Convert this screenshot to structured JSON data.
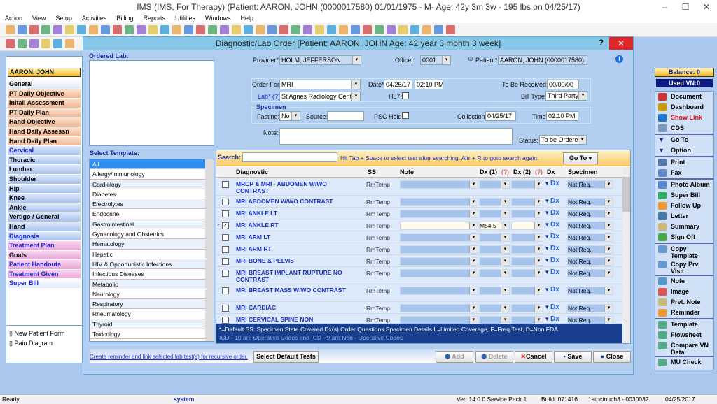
{
  "app": {
    "title": "IMS (IMS, For Therapy)    (Patient: AARON, JOHN  (0000017580) 01/01/1975 - M- Age: 42y 3m 3w - 195 lbs on 04/25/17)"
  },
  "menu": [
    "Action",
    "View",
    "Setup",
    "Activities",
    "Billing",
    "Reports",
    "Utilities",
    "Windows",
    "Help"
  ],
  "sidebar": {
    "patient": "AARON, JOHN",
    "items": [
      {
        "label": "General",
        "style": "w",
        "blue": false
      },
      {
        "label": "PT Daily Objective",
        "style": "o",
        "blue": false
      },
      {
        "label": "Initail Assessment",
        "style": "o",
        "blue": false
      },
      {
        "label": "PT Daily Plan",
        "style": "o",
        "blue": false
      },
      {
        "label": "Hand Objective",
        "style": "o",
        "blue": false
      },
      {
        "label": "Hand Daily Assessn",
        "style": "o",
        "blue": false
      },
      {
        "label": "Hand Daily Plan",
        "style": "o",
        "blue": false
      },
      {
        "label": "Cervical",
        "style": "b",
        "blue": true
      },
      {
        "label": "Thoracic",
        "style": "b",
        "blue": false
      },
      {
        "label": "Lumbar",
        "style": "b",
        "blue": false
      },
      {
        "label": "Shoulder",
        "style": "b",
        "blue": false
      },
      {
        "label": "Hip",
        "style": "b",
        "blue": false
      },
      {
        "label": "Knee",
        "style": "b",
        "blue": false
      },
      {
        "label": "Ankle",
        "style": "b",
        "blue": false
      },
      {
        "label": "Vertigo / General",
        "style": "b",
        "blue": false
      },
      {
        "label": "Hand",
        "style": "b",
        "blue": false
      },
      {
        "label": "Diagnosis",
        "style": "b",
        "blue": true
      },
      {
        "label": "Treatment Plan",
        "style": "p",
        "blue": true
      },
      {
        "label": "Goals",
        "style": "p",
        "blue": false
      },
      {
        "label": "Patient Handouts",
        "style": "p",
        "blue": true
      },
      {
        "label": "Treatment Given",
        "style": "p",
        "blue": true
      },
      {
        "label": "Super Bill",
        "style": "w",
        "blue": true
      }
    ],
    "shortcuts": [
      "New Patient Form",
      "Pain Diagram"
    ]
  },
  "dialog": {
    "title": "Diagnostic/Lab Order  [Patient: AARON, JOHN   Age: 42 year 3 month 3 week]",
    "help": "?",
    "close": "✕",
    "ordered_lab_label": "Ordered Lab:",
    "provider_label": "Provider*",
    "provider": "HOLM, JEFFERSON",
    "office_label": "Office:",
    "office": "0001",
    "patient_label": "Patient* (?)",
    "patient": "AARON, JOHN  (0000017580)",
    "order_for_label": "Order For*",
    "order_for": "MRI",
    "date_label": "Date*",
    "date": "04/25/17",
    "time": "02:10 PM",
    "to_be_received_label": "To Be Received:",
    "to_be_received": "00/00/00",
    "lab_label": "Lab* (?)",
    "lab": "St Agnes Radiology Center",
    "hl7_label": "HL7:",
    "bill_type_label": "Bill Type:",
    "bill_type": "Third Party",
    "specimen_label": "Specimen",
    "fasting_label": "Fasting:",
    "fasting": "No",
    "source_label": "Source:",
    "source": "",
    "psc_hold_label": "PSC Hold:",
    "collection_label": "Collection:",
    "collection": "04/25/17",
    "ctime_label": "Time:",
    "ctime": "02:10 PM",
    "note_label": "Note:",
    "note": "",
    "status_label": "Status:",
    "status": "To be Ordered",
    "template_label": "Select Template:",
    "templates": [
      "All",
      "Allergy/Immunology",
      "Cardiology",
      "Diabetes",
      "Electrolytes",
      "Endocrine",
      "Gastrointestinal",
      "Gynecology and Obstetrics",
      "Hematology",
      "Hepatic",
      "HIV & Opportunistic Infections",
      "Infectious Diseases",
      "Metabolic",
      "Neurology",
      "Respiratory",
      "Rheumatology",
      "Thyroid",
      "Toxicology"
    ],
    "search_label": "Search:",
    "search_value": "",
    "search_hint": "Hit Tab + Space to select test after searching. Altr + R to goto search again.",
    "goto": "Go To",
    "columns": [
      "Diagnostic",
      "SS",
      "Note",
      "Dx (1)",
      "(?)",
      "Dx (2)",
      "(?)",
      "Dx",
      "Specimen"
    ],
    "rows": [
      {
        "name": "MRCP & MRI - ABDOMEN W/WO CONTRAST",
        "ss": "RmTemp",
        "checked": false,
        "dx1": "",
        "specimen": "Not Req."
      },
      {
        "name": "MRI ABDOMEN W/WO CONTRAST",
        "ss": "RmTemp",
        "checked": false,
        "dx1": "",
        "specimen": "Not Req."
      },
      {
        "name": "MRI ANKLE LT",
        "ss": "RmTemp",
        "checked": false,
        "dx1": "",
        "specimen": "Not Req."
      },
      {
        "name": "MRI ANKLE RT",
        "ss": "RmTemp",
        "checked": true,
        "dx1": "M54.5",
        "specimen": "Not Req."
      },
      {
        "name": "MRI ARM LT",
        "ss": "RmTemp",
        "checked": false,
        "dx1": "",
        "specimen": "Not Req."
      },
      {
        "name": "MRI ARM RT",
        "ss": "RmTemp",
        "checked": false,
        "dx1": "",
        "specimen": "Not Req."
      },
      {
        "name": "MRI BONE & PELVIS",
        "ss": "RmTemp",
        "checked": false,
        "dx1": "",
        "specimen": "Not Req."
      },
      {
        "name": "MRI BREAST IMPLANT RUPTURE NO CONTRAST",
        "ss": "RmTemp",
        "checked": false,
        "dx1": "",
        "specimen": "Not Req."
      },
      {
        "name": "MRI BREAST MASS W/WO CONTRAST",
        "ss": "RmTemp",
        "checked": false,
        "dx1": "",
        "specimen": "Not Req."
      },
      {
        "name": "MRI CARDIAC",
        "ss": "RmTemp",
        "checked": false,
        "dx1": "",
        "specimen": "Not Req."
      },
      {
        "name": "MRI CERVICAL SPINE NON",
        "ss": "RmTemp",
        "checked": false,
        "dx1": "",
        "specimen": "Not Req."
      }
    ],
    "legend1": "*=Default   SS: Specimen State    Covered Dx(s)    Order Questions    Specimen Details    L=Limited Coverage, F=Freq.Test, D=Non FDA",
    "legend2": "ICD - 10 are Operative Codes and ICD - 9 are Non - Operative Codes",
    "recursive_link": "Create reminder and link selected lab test(s) for recursive order.",
    "select_default": "Select Default Tests",
    "add": "Add",
    "delete": "Delete",
    "cancel": "Cancel",
    "save": "Save",
    "close_btn": "Close"
  },
  "right": {
    "balance": "Balance: 0",
    "used_vn": "Used VN:0",
    "groups": [
      [
        {
          "label": "Document",
          "color": "#c33"
        },
        {
          "label": "Dashboard",
          "color": "#c90"
        },
        {
          "label": "Show Link",
          "color": "#27c",
          "red": true
        },
        {
          "label": "CDS",
          "color": "#79b"
        }
      ],
      [
        {
          "label": "Go To",
          "color": "#1a2a9a"
        },
        {
          "label": "Option",
          "color": "#1a2a9a"
        }
      ],
      [
        {
          "label": "Print",
          "color": "#57a"
        },
        {
          "label": "Fax",
          "color": "#68c"
        }
      ],
      [
        {
          "label": "Photo Album",
          "color": "#58c"
        },
        {
          "label": "Super Bill",
          "color": "#3a6"
        },
        {
          "label": "Follow Up",
          "color": "#e93"
        },
        {
          "label": "Letter",
          "color": "#47a"
        },
        {
          "label": "Summary",
          "color": "#cb7"
        },
        {
          "label": "Sign Off",
          "color": "#4a4"
        }
      ],
      [
        {
          "label": "Copy Template",
          "color": "#69c"
        },
        {
          "label": "Copy Prv. Visit",
          "color": "#69c"
        }
      ],
      [
        {
          "label": "Note",
          "color": "#59c"
        },
        {
          "label": "Image",
          "color": "#d55"
        },
        {
          "label": "Prvt. Note",
          "color": "#cb7"
        },
        {
          "label": "Reminder",
          "color": "#e93"
        }
      ],
      [
        {
          "label": "Template",
          "color": "#5a8"
        },
        {
          "label": "Flowsheet",
          "color": "#5a8"
        },
        {
          "label": "Compare VN Data",
          "color": "#5a8"
        }
      ],
      [
        {
          "label": "MU Check",
          "color": "#5a8"
        }
      ]
    ]
  },
  "status": {
    "ready": "Ready",
    "user": "system",
    "version": "Ver: 14.0.0 Service Pack 1",
    "build": "Build: 071416",
    "station": "1stpctouch3 - 0030032",
    "date": "04/25/2017"
  }
}
